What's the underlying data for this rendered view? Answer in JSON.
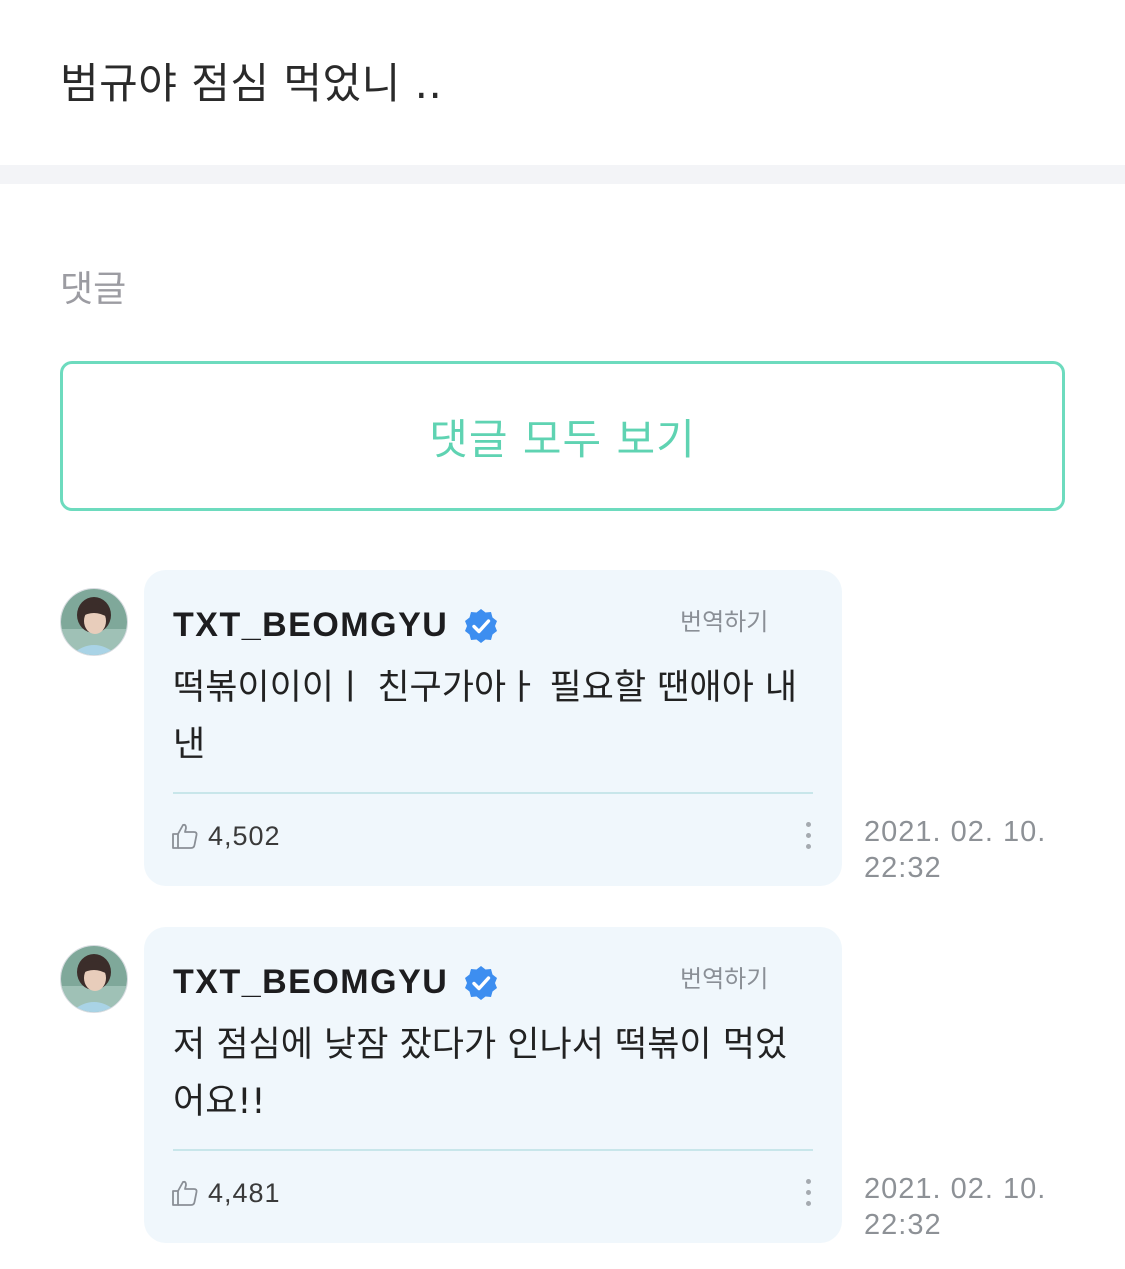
{
  "post": {
    "body": "범규야 점심 먹었니 .."
  },
  "comments_section": {
    "title": "댓글",
    "view_all_label": "댓글 모두 보기"
  },
  "comments": [
    {
      "author": "TXT_BEOMGYU",
      "verified": true,
      "translate_label": "번역하기",
      "text": "떡볶이이이ㅣ  친구가아ㅏ  필요할 땐애아 내낸",
      "likes": "4,502",
      "timestamp_date": "2021. 02. 10.",
      "timestamp_time": "22:32"
    },
    {
      "author": "TXT_BEOMGYU",
      "verified": true,
      "translate_label": "번역하기",
      "text": "저 점심에 낮잠 잤다가 인나서 떡볶이 먹었어요!!",
      "likes": "4,481",
      "timestamp_date": "2021. 02. 10.",
      "timestamp_time": "22:32"
    }
  ],
  "colors": {
    "accent": "#5fd3b2",
    "bubble_bg": "#f0f7fc",
    "verified": "#3d8ef0"
  }
}
